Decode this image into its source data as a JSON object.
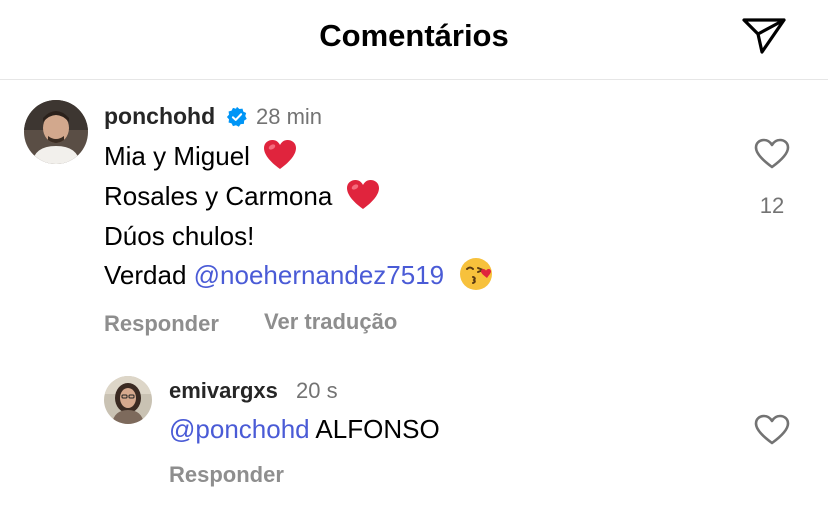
{
  "header": {
    "title": "Comentários",
    "share_icon": "paper-plane-icon"
  },
  "comments": [
    {
      "username": "ponchohd",
      "verified": true,
      "time": "28 min",
      "lines": [
        {
          "text": "Mia y Miguel",
          "emoji": "red-heart"
        },
        {
          "text": "Rosales y Carmona",
          "emoji": "red-heart"
        },
        {
          "text": "Dúos chulos!"
        },
        {
          "prefix": "Verdad ",
          "mention": "@noehernandez7519",
          "emoji": "face-blowing-kiss"
        }
      ],
      "actions": {
        "reply": "Responder",
        "translate": "Ver tradução"
      },
      "likes": "12"
    },
    {
      "username": "emivargxs",
      "time": "20 s",
      "mention": "@ponchohd",
      "text": " ALFONSO",
      "actions": {
        "reply": "Responder"
      }
    }
  ],
  "colors": {
    "mention": "#4a5bd6",
    "verified": "#0095f6",
    "heart": "#e0245e"
  }
}
